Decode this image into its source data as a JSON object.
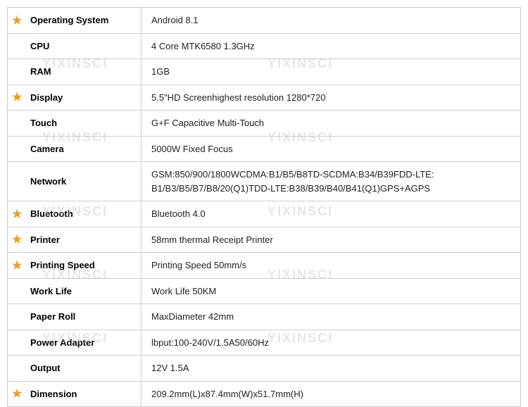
{
  "watermarks": [
    "YIXINSCI",
    "YIXINSCI",
    "YIXINSCI",
    "YIXINSCI",
    "YIXINSCI",
    "YIXINSCI",
    "YIXINSCI",
    "YIXINSCI",
    "YIXINSCI",
    "YIXINSCI"
  ],
  "rows": [
    {
      "label": "Operating System",
      "value": "Android 8.1",
      "star": true
    },
    {
      "label": "CPU",
      "value": "4 Core MTK6580 1.3GHz",
      "star": false
    },
    {
      "label": "RAM",
      "value": "1GB",
      "star": false
    },
    {
      "label": "Display",
      "value": "5.5\"HD Screenhighest resolution 1280*720",
      "star": true
    },
    {
      "label": "Touch",
      "value": "G+F Capacitive Multi-Touch",
      "star": false
    },
    {
      "label": "Camera",
      "value": "5000W Fixed Focus",
      "star": false
    },
    {
      "label": "Network",
      "value": "GSM:850/900/1800WCDMA:B1/B5/B8TD-SCDMA:B34/B39FDD-LTE:B1/B3/B5/B7/B8/20(Q1)TDD-LTE:B38/B39/B40/B41(Q1)GPS+AGPS",
      "star": false,
      "multiline": true
    },
    {
      "label": "Bluetooth",
      "value": "Bluetooth 4.0",
      "star": true
    },
    {
      "label": "Printer",
      "value": "58mm thermal Receipt Printer",
      "star": true
    },
    {
      "label": "Printing Speed",
      "value": "Printing Speed 50mm/s",
      "star": true
    },
    {
      "label": "Work Life",
      "value": "Work Life 50KM",
      "star": false
    },
    {
      "label": "Paper Roll",
      "value": "MaxDiameter 42mm",
      "star": false
    },
    {
      "label": "Power Adapter",
      "value": "lbput:100-240V/1.5A50/60Hz",
      "star": false
    },
    {
      "label": "Output",
      "value": "12V 1.5A",
      "star": false
    },
    {
      "label": "Dimension",
      "value": "209.2mm(L)x87.4mm(W)x51.7mm(H)",
      "star": true
    }
  ]
}
